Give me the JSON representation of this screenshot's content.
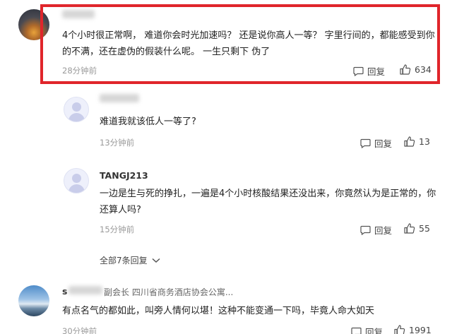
{
  "comments": [
    {
      "username": "",
      "text": "4个小时很正常啊， 难道你会时光加速吗？ 还是说你高人一等？ 字里行间的，都能感受到你的不满，还在虚伪的假装什么呢。 一生只剩下 伪了",
      "time": "28分钟前",
      "reply_label": "回复",
      "likes": "634"
    }
  ],
  "replies": [
    {
      "username": "",
      "text": "难道我就该低人一等了?",
      "time": "13分钟前",
      "reply_label": "回复",
      "likes": "13"
    },
    {
      "username": "TANGJ213",
      "text": "一边是生与死的挣扎，一遍是4个小时核酸结果还没出来，你竟然认为是正常的，你还算人吗?",
      "time": "15分钟前",
      "reply_label": "回复",
      "likes": "55"
    }
  ],
  "expand_replies_label": "全部7条回复",
  "comment2": {
    "username_fragment": "s",
    "meta": "副会长 四川省商务酒店协会公寓...",
    "text": "有点名气的都如此，叫旁人情何以堪！这种不能变通一下吗，毕竟人命大如天",
    "time": "30分钟前",
    "reply_label": "回复",
    "likes": "1991"
  },
  "colors": {
    "highlight": "#e0252b",
    "muted": "#9a9a9a"
  }
}
